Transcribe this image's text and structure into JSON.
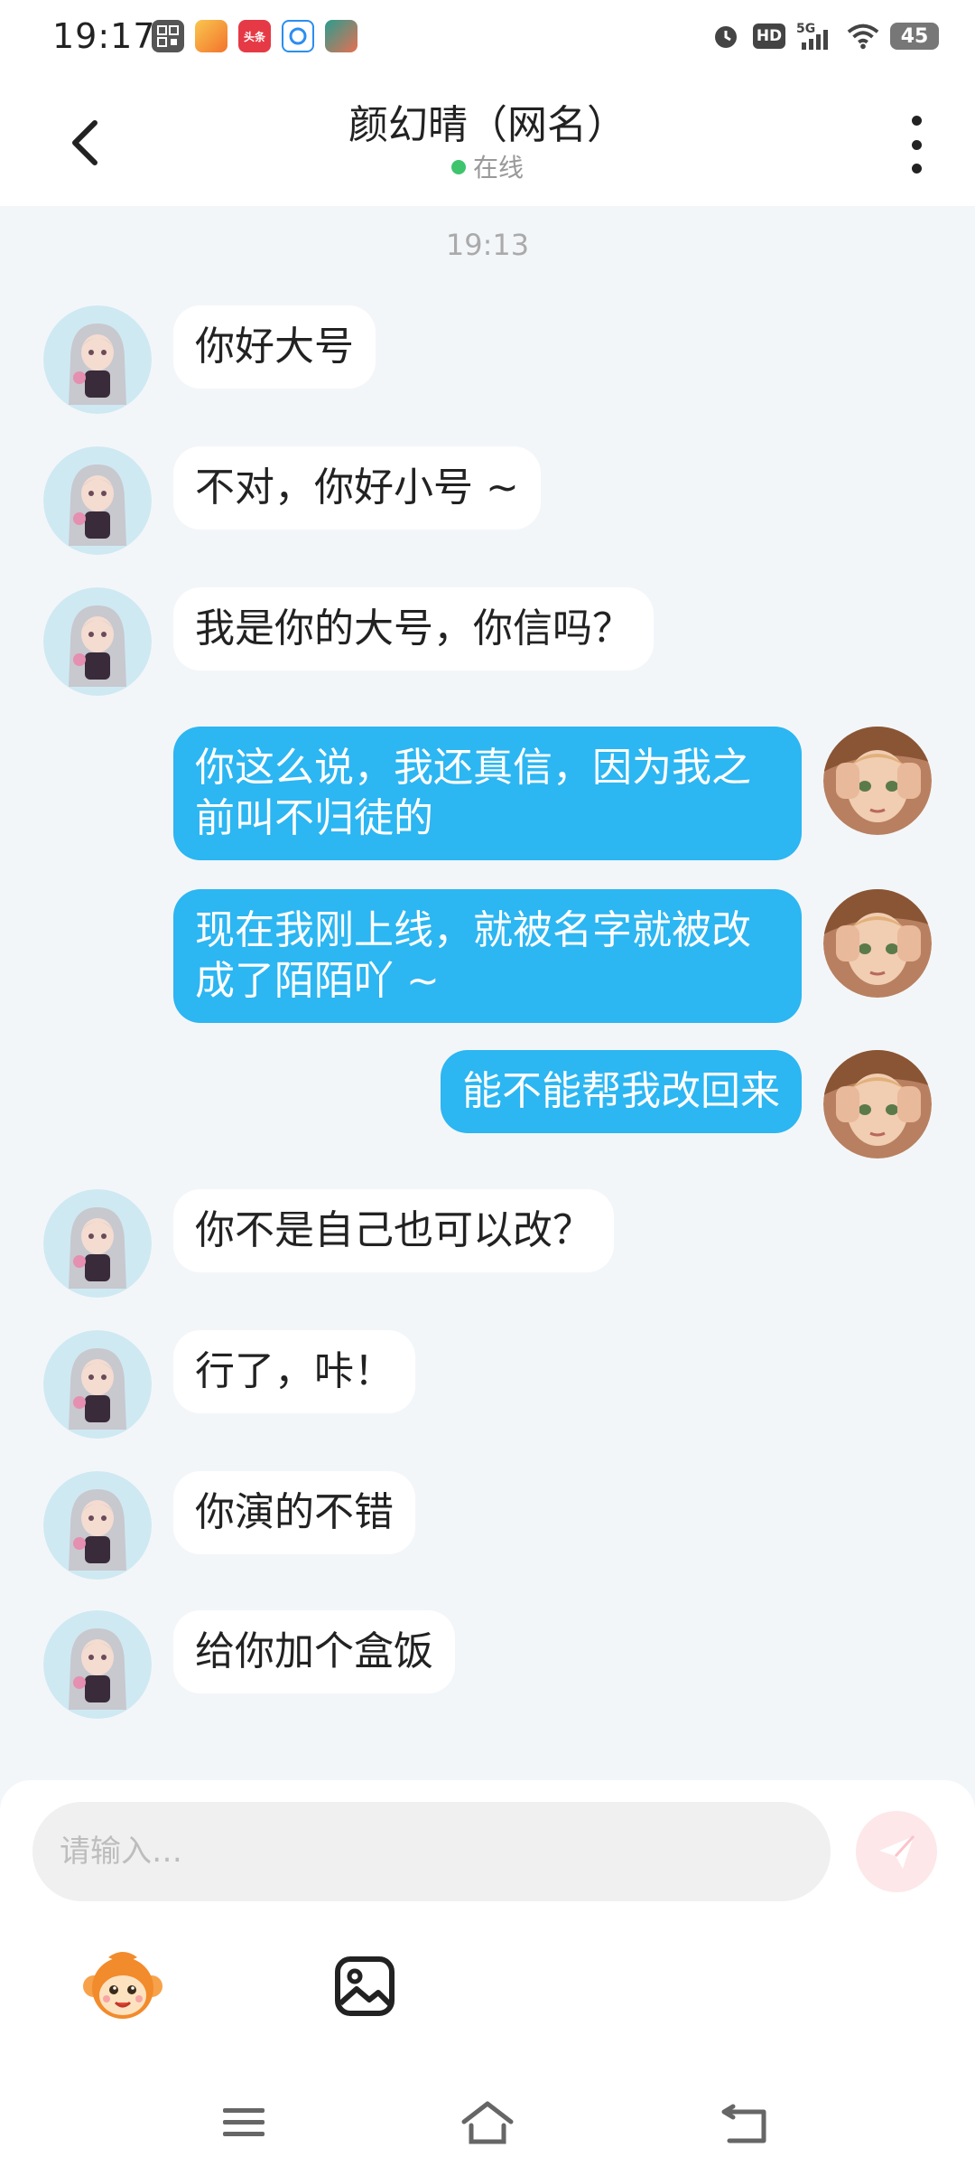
{
  "status_bar": {
    "time": "19:17",
    "network": "5G",
    "hd": "HD",
    "battery": "45",
    "app_icons": [
      "qr-app-icon",
      "game-app-icon",
      "toutiao-app-icon",
      "browser-app-icon",
      "game2-app-icon"
    ],
    "toutiao_label": "头条"
  },
  "header": {
    "title": "颜幻晴（网名）",
    "status": "在线",
    "status_color": "#3ec46d"
  },
  "chat": {
    "timestamp": "19:13",
    "messages": [
      {
        "side": "in",
        "text": "你好大号"
      },
      {
        "side": "in",
        "text": "不对，你好小号 ~"
      },
      {
        "side": "in",
        "text": "我是你的大号，你信吗？"
      },
      {
        "side": "out",
        "text": "你这么说，我还真信，因为我之前叫不归徒的"
      },
      {
        "side": "out",
        "text": "现在我刚上线，就被名字就被改成了陌陌吖 ~"
      },
      {
        "side": "out",
        "text": "能不能帮我改回来"
      },
      {
        "side": "in",
        "text": "你不是自己也可以改？"
      },
      {
        "side": "in",
        "text": "行了，咔！"
      },
      {
        "side": "in",
        "text": "你演的不错"
      },
      {
        "side": "in",
        "text": "给你加个盒饭"
      }
    ]
  },
  "composer": {
    "placeholder": "请输入…",
    "send_color": "#fde7e9"
  },
  "colors": {
    "outgoing_bubble": "#2cb6f2",
    "incoming_bubble": "#ffffff",
    "background": "#f3f6f9"
  }
}
